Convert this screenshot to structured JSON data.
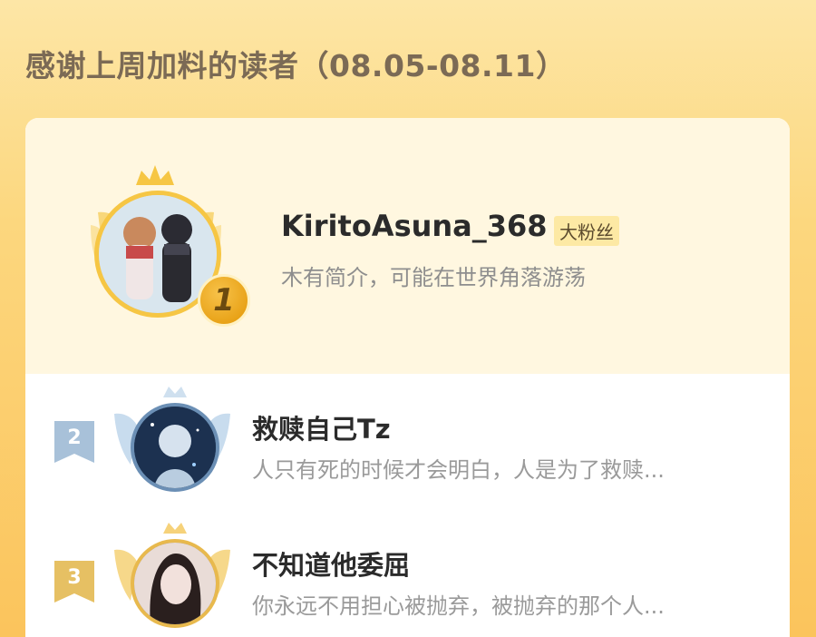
{
  "header": {
    "title": "感谢上周加料的读者（08.05-08.11）"
  },
  "colors": {
    "background_gold": "#fbc45c",
    "rank1_gold": "#f6c644",
    "rank2_silver_blue": "#9ab4cf",
    "rank3_bronze_gold": "#e6c063"
  },
  "leaderboard": {
    "top": {
      "rank": "1",
      "name": "KiritoAsuna_368",
      "tag": "大粉丝",
      "bio": "木有简介，可能在世界角落游荡",
      "avatar_icon": "anime-couple-avatar",
      "badge_icon": "gold-rank-medal-icon"
    },
    "rows": [
      {
        "rank": "2",
        "name": "救赎自己Tz",
        "bio": "人只有死的时候才会明白，人是为了救赎...",
        "avatar_icon": "anime-girl-avatar",
        "ribbon_icon": "silver-rank-ribbon-icon"
      },
      {
        "rank": "3",
        "name": "不知道他委屈",
        "bio": "你永远不用担心被抛弃，被抛弃的那个人...",
        "avatar_icon": "girl-portrait-avatar",
        "ribbon_icon": "bronze-rank-ribbon-icon"
      }
    ]
  }
}
